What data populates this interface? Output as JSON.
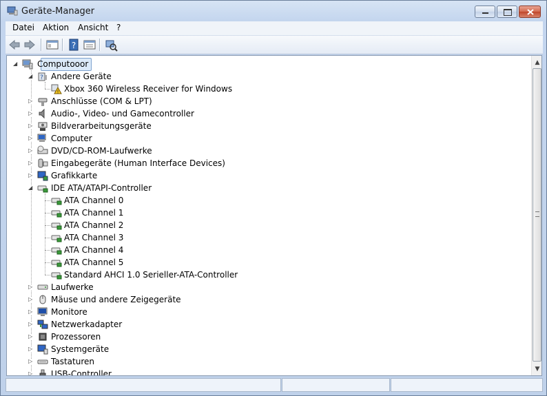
{
  "window": {
    "title": "Geräte-Manager"
  },
  "menu": {
    "items": [
      "Datei",
      "Aktion",
      "Ansicht",
      "?"
    ]
  },
  "tree": {
    "root": "Computooor",
    "nodes": [
      {
        "label": "Andere Geräte",
        "level": 1,
        "expanded": true,
        "icon": "unknown-device-icon"
      },
      {
        "label": "Xbox 360 Wireless Receiver for Windows",
        "level": 2,
        "icon": "warning-device-icon"
      },
      {
        "label": "Anschlüsse (COM & LPT)",
        "level": 1,
        "expanded": false,
        "icon": "port-icon"
      },
      {
        "label": "Audio-, Video- und Gamecontroller",
        "level": 1,
        "expanded": false,
        "icon": "speaker-icon"
      },
      {
        "label": "Bildverarbeitungsgeräte",
        "level": 1,
        "expanded": false,
        "icon": "camera-icon"
      },
      {
        "label": "Computer",
        "level": 1,
        "expanded": false,
        "icon": "computer-icon"
      },
      {
        "label": "DVD/CD-ROM-Laufwerke",
        "level": 1,
        "expanded": false,
        "icon": "disc-drive-icon"
      },
      {
        "label": "Eingabegeräte (Human Interface Devices)",
        "level": 1,
        "expanded": false,
        "icon": "hid-icon"
      },
      {
        "label": "Grafikkarte",
        "level": 1,
        "expanded": false,
        "icon": "display-adapter-icon"
      },
      {
        "label": "IDE ATA/ATAPI-Controller",
        "level": 1,
        "expanded": true,
        "icon": "controller-icon"
      },
      {
        "label": "ATA Channel 0",
        "level": 2,
        "icon": "controller-icon"
      },
      {
        "label": "ATA Channel 1",
        "level": 2,
        "icon": "controller-icon"
      },
      {
        "label": "ATA Channel 2",
        "level": 2,
        "icon": "controller-icon"
      },
      {
        "label": "ATA Channel 3",
        "level": 2,
        "icon": "controller-icon"
      },
      {
        "label": "ATA Channel 4",
        "level": 2,
        "icon": "controller-icon"
      },
      {
        "label": "ATA Channel 5",
        "level": 2,
        "icon": "controller-icon"
      },
      {
        "label": "Standard AHCI 1.0 Serieller-ATA-Controller",
        "level": 2,
        "icon": "controller-icon"
      },
      {
        "label": "Laufwerke",
        "level": 1,
        "expanded": false,
        "icon": "drive-icon"
      },
      {
        "label": "Mäuse und andere Zeigegeräte",
        "level": 1,
        "expanded": false,
        "icon": "mouse-icon"
      },
      {
        "label": "Monitore",
        "level": 1,
        "expanded": false,
        "icon": "monitor-icon"
      },
      {
        "label": "Netzwerkadapter",
        "level": 1,
        "expanded": false,
        "icon": "network-icon"
      },
      {
        "label": "Prozessoren",
        "level": 1,
        "expanded": false,
        "icon": "processor-icon"
      },
      {
        "label": "Systemgeräte",
        "level": 1,
        "expanded": false,
        "icon": "system-device-icon"
      },
      {
        "label": "Tastaturen",
        "level": 1,
        "expanded": false,
        "icon": "keyboard-icon"
      },
      {
        "label": "USB-Controller",
        "level": 1,
        "expanded": false,
        "icon": "usb-icon"
      }
    ]
  },
  "colors": {
    "selection": "#dceaf9",
    "accent": "#3b6fb6"
  }
}
